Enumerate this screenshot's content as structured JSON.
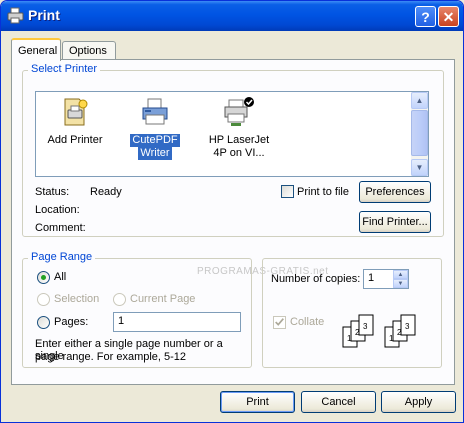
{
  "window": {
    "title": "Print",
    "help_label": "?",
    "close_label": "✕"
  },
  "tabs": [
    {
      "label": "General",
      "active": true
    },
    {
      "label": "Options",
      "active": false
    }
  ],
  "select_printer": {
    "group_label": "Select Printer",
    "printers": [
      {
        "label_line1": "Add Printer",
        "label_line2": "",
        "icon": "add-printer-icon",
        "selected": false
      },
      {
        "label_line1": "CutePDF",
        "label_line2": "Writer",
        "icon": "printer-icon",
        "selected": true
      },
      {
        "label_line1": "HP LaserJet",
        "label_line2": "4P on VI...",
        "icon": "network-default-printer-icon",
        "selected": false
      }
    ],
    "status_label": "Status:",
    "status_value": "Ready",
    "location_label": "Location:",
    "comment_label": "Comment:",
    "print_to_file_label": "Print to file",
    "print_to_file_checked": false,
    "preferences_label": "Preferences",
    "find_printer_label": "Find Printer..."
  },
  "page_range": {
    "group_label": "Page Range",
    "all_label": "All",
    "selection_label": "Selection",
    "current_page_label": "Current Page",
    "pages_label": "Pages:",
    "pages_value": "1",
    "help_line1": "Enter either a single page number or a single",
    "help_line2": "page range.  For example, 5-12",
    "selected_option": "All"
  },
  "copies": {
    "label": "Number of copies:",
    "value": "1",
    "collate_label": "Collate",
    "collate_checked": true,
    "collate_icon_pages": [
      "1",
      "2",
      "3"
    ]
  },
  "watermark": "PROGRAMAS-GRATIS.net",
  "buttons": {
    "print": "Print",
    "cancel": "Cancel",
    "apply": "Apply"
  },
  "colors": {
    "title_bar": "#0054e3",
    "group_label": "#0046d5",
    "selection": "#316ac5",
    "dialog_bg": "#ece9d8"
  }
}
